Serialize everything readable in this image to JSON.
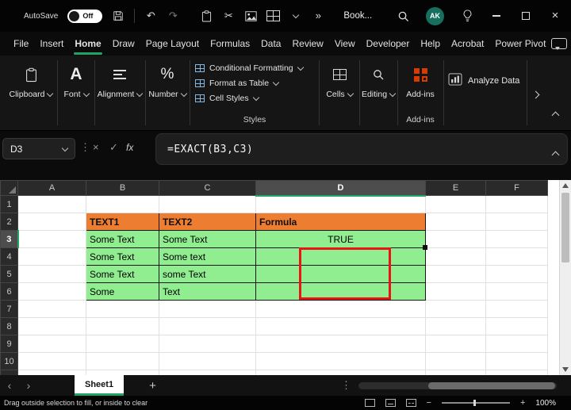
{
  "titlebar": {
    "autosave_label": "AutoSave",
    "autosave_state": "Off",
    "doc_title": "Book...",
    "avatar_initials": "AK"
  },
  "glyphs": {
    "undo": "↶",
    "redo": "↷",
    "cut": "✂",
    "more": "»",
    "ellipsis_v": "⋮",
    "cancel": "×",
    "check": "✓",
    "close": "×",
    "prev": "‹",
    "next": "›",
    "add_sheet": "+",
    "percent": "%",
    "font_letter": "A",
    "zoom_minus": "−",
    "zoom_plus": "+"
  },
  "menubar": {
    "tabs": [
      "File",
      "Insert",
      "Home",
      "Draw",
      "Page Layout",
      "Formulas",
      "Data",
      "Review",
      "View",
      "Developer",
      "Help",
      "Acrobat",
      "Power Pivot"
    ],
    "active_tab": "Home"
  },
  "ribbon": {
    "clipboard": "Clipboard",
    "font": "Font",
    "alignment": "Alignment",
    "number": "Number",
    "styles_items": [
      "Conditional Formatting",
      "Format as Table",
      "Cell Styles"
    ],
    "styles_caption": "Styles",
    "cells": "Cells",
    "editing": "Editing",
    "addins": "Add-ins",
    "addins_caption": "Add-ins",
    "analyze": "Analyze Data"
  },
  "formula_bar": {
    "name_box": "D3",
    "fx_label": "fx",
    "formula": "=EXACT(B3,C3)"
  },
  "sheet": {
    "columns": [
      "A",
      "B",
      "C",
      "D",
      "E",
      "F"
    ],
    "rows": [
      "1",
      "2",
      "3",
      "4",
      "5",
      "6",
      "7",
      "8",
      "9",
      "10"
    ],
    "selected_column": "D",
    "selected_row": "3",
    "active_cell": "D3",
    "cells": {
      "B2": "TEXT1",
      "C2": "TEXT2",
      "D2": "Formula",
      "B3": "Some Text",
      "C3": "Some Text",
      "D3": "TRUE",
      "B4": "Some Text",
      "C4": "Some text",
      "B5": "Some Text",
      "C5": "some Text",
      "B6": "Some",
      "C6": "Text"
    }
  },
  "sheet_tabs": {
    "tab": "Sheet1"
  },
  "status_bar": {
    "hint": "Drag outside selection to fill, or inside to clear",
    "zoom": "100%"
  },
  "colors": {
    "accent_green": "#1FA463",
    "table_header_fill": "#ED7D31",
    "table_data_fill": "#90EE90",
    "annotation_red": "#E81515",
    "addins_orange": "#D83B01",
    "avatar_teal": "#176F5F"
  }
}
